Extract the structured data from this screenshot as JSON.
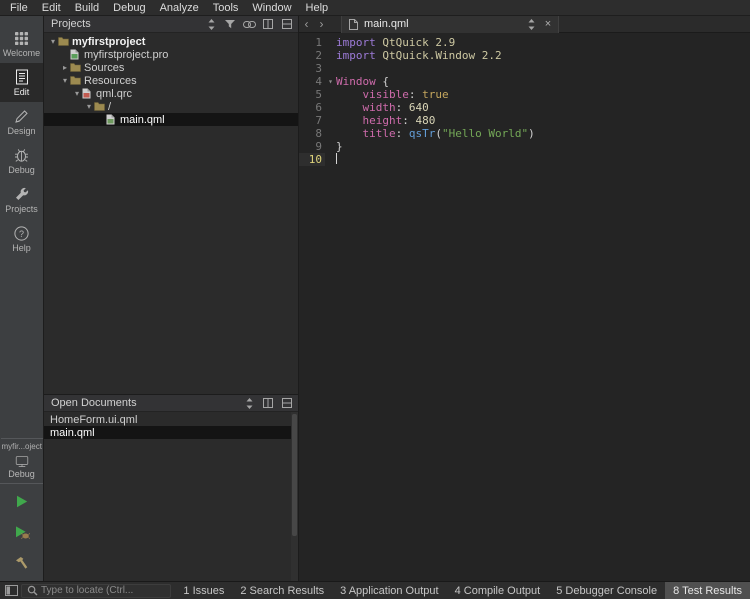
{
  "colors": {
    "run_green": "#40a84c",
    "selection_bg": "#141414",
    "current_line_number": "#ded37a",
    "string_green": "#74a857",
    "keyword_violet": "#9d7bd8",
    "property_pink": "#ce6bab"
  },
  "icons": {
    "back": "‹",
    "forward": "›",
    "close": "×",
    "expand_open": "▾",
    "expand_closed": "▸"
  },
  "menubar": {
    "items": [
      "File",
      "Edit",
      "Build",
      "Debug",
      "Analyze",
      "Tools",
      "Window",
      "Help"
    ]
  },
  "mode_sidebar": {
    "items": [
      {
        "label": "Welcome",
        "icon": "welcome",
        "active": false
      },
      {
        "label": "Edit",
        "icon": "edit",
        "active": true
      },
      {
        "label": "Design",
        "icon": "design",
        "active": false
      },
      {
        "label": "Debug",
        "icon": "debug",
        "active": false
      },
      {
        "label": "Projects",
        "icon": "projects",
        "active": false
      },
      {
        "label": "Help",
        "icon": "help",
        "active": false
      }
    ],
    "kit_label": "myfir...oject",
    "build_config": "Debug"
  },
  "projects_panel": {
    "title": "Projects",
    "header_icons": [
      "combo-arrows",
      "filter",
      "link-with-editor",
      "split",
      "close-panel"
    ],
    "tree": [
      {
        "label": "myfirstproject",
        "depth": 0,
        "icon": "folder",
        "expanded": true,
        "bold": true
      },
      {
        "label": "myfirstproject.pro",
        "depth": 1,
        "icon": "pro-file"
      },
      {
        "label": "Sources",
        "depth": 1,
        "icon": "folder",
        "expanded": false
      },
      {
        "label": "Resources",
        "depth": 1,
        "icon": "folder",
        "expanded": true
      },
      {
        "label": "qml.qrc",
        "depth": 2,
        "icon": "qrc-file",
        "expanded": true
      },
      {
        "label": "/",
        "depth": 3,
        "icon": "folder",
        "expanded": true
      },
      {
        "label": "main.qml",
        "depth": 4,
        "icon": "qml-file",
        "selected": true
      }
    ]
  },
  "open_documents_panel": {
    "title": "Open Documents",
    "header_icons": [
      "combo-arrows",
      "split",
      "close-panel"
    ],
    "documents": [
      {
        "label": "HomeForm.ui.qml",
        "selected": false
      },
      {
        "label": "main.qml",
        "selected": true
      }
    ]
  },
  "editor": {
    "tab_title": "main.qml",
    "lines": [
      {
        "n": "1",
        "tokens": [
          [
            "kw",
            "import"
          ],
          [
            "mod",
            " QtQuick 2.9"
          ]
        ]
      },
      {
        "n": "2",
        "tokens": [
          [
            "kw",
            "import"
          ],
          [
            "mod",
            " QtQuick.Window 2.2"
          ]
        ]
      },
      {
        "n": "3",
        "tokens": []
      },
      {
        "n": "4",
        "fold": true,
        "tokens": [
          [
            "type",
            "Window"
          ],
          [
            "plain",
            " {"
          ]
        ]
      },
      {
        "n": "5",
        "tokens": [
          [
            "plain",
            "    "
          ],
          [
            "prop",
            "visible"
          ],
          [
            "plain",
            ": "
          ],
          [
            "val",
            "true"
          ]
        ]
      },
      {
        "n": "6",
        "tokens": [
          [
            "plain",
            "    "
          ],
          [
            "prop",
            "width"
          ],
          [
            "plain",
            ": "
          ],
          [
            "num",
            "640"
          ]
        ]
      },
      {
        "n": "7",
        "tokens": [
          [
            "plain",
            "    "
          ],
          [
            "prop",
            "height"
          ],
          [
            "plain",
            ": "
          ],
          [
            "num",
            "480"
          ]
        ]
      },
      {
        "n": "8",
        "tokens": [
          [
            "plain",
            "    "
          ],
          [
            "prop",
            "title"
          ],
          [
            "plain",
            ": "
          ],
          [
            "fn",
            "qsTr"
          ],
          [
            "plain",
            "("
          ],
          [
            "str",
            "\"Hello World\""
          ],
          [
            "plain",
            ")"
          ]
        ]
      },
      {
        "n": "9",
        "tokens": [
          [
            "plain",
            "}"
          ]
        ]
      },
      {
        "n": "10",
        "current": true,
        "cursor": true,
        "tokens": []
      }
    ]
  },
  "status_bar": {
    "locator_placeholder": "Type to locate (Ctrl...",
    "panes": [
      {
        "label": "1 Issues",
        "active": false
      },
      {
        "label": "2 Search Results",
        "active": false
      },
      {
        "label": "3 Application Output",
        "active": false
      },
      {
        "label": "4 Compile Output",
        "active": false
      },
      {
        "label": "5 Debugger Console",
        "active": false
      },
      {
        "label": "8 Test Results",
        "active": true
      }
    ]
  }
}
